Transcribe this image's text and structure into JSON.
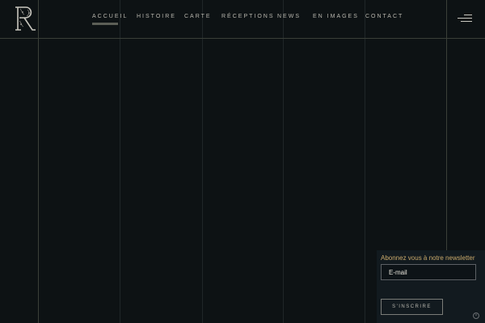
{
  "nav": {
    "items": [
      {
        "label": "ACCUEIL",
        "active": true
      },
      {
        "label": "HISTOIRE",
        "active": false
      },
      {
        "label": "CARTE",
        "active": false
      },
      {
        "label": "RÉCEPTIONS",
        "active": false
      },
      {
        "label": "NEWS",
        "active": false
      },
      {
        "label": "EN IMAGES",
        "active": false
      },
      {
        "label": "CONTACT",
        "active": false
      }
    ]
  },
  "logo": {
    "icon": "ornate-letter-r-logo"
  },
  "menu": {
    "icon": "hamburger-menu-icon"
  },
  "newsletter": {
    "label": "Abonnez vous à notre newsletter",
    "email_placeholder": "E-mail",
    "submit_label": "S'INSCRIRE"
  },
  "colors": {
    "background": "#0d1214",
    "accent_gold": "#c9a96a",
    "nav_text": "#b8b6ae"
  }
}
